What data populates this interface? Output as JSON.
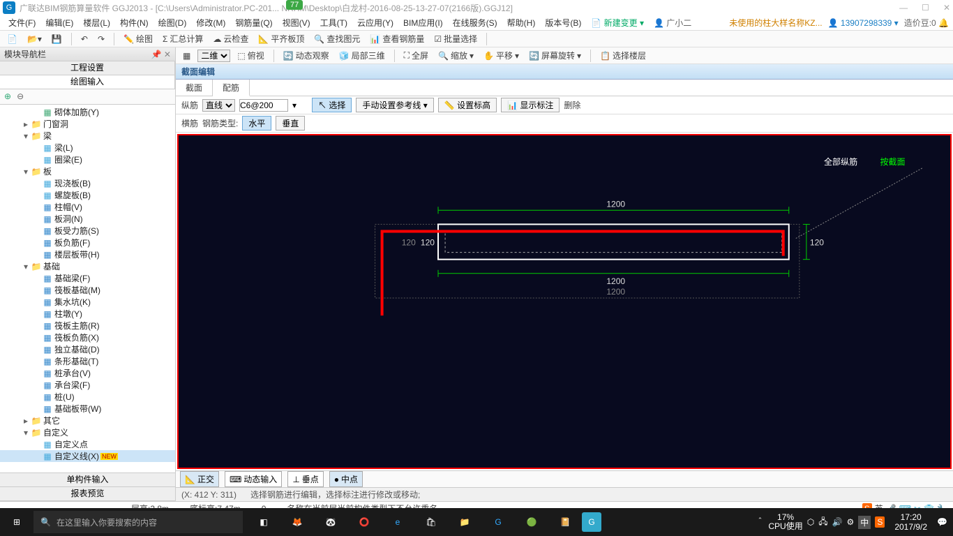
{
  "title": {
    "app": "广联达BIM钢筋算量软件 GGJ2013",
    "path": "- [C:\\Users\\Administrator.PC-201... NRHM\\Desktop\\白龙村-2016-08-25-13-27-07(2166版).GGJ12]",
    "badge": "77"
  },
  "menu": [
    "文件(F)",
    "编辑(E)",
    "楼层(L)",
    "构件(N)",
    "绘图(D)",
    "修改(M)",
    "钢筋量(Q)",
    "视图(V)",
    "工具(T)",
    "云应用(Y)",
    "BIM应用(I)",
    "在线服务(S)",
    "帮助(H)",
    "版本号(B)"
  ],
  "menu_right": {
    "new_change": "新建变更",
    "user": "广小二",
    "warn": "未使用的柱大样名称KZ...",
    "phone": "13907298339",
    "bean": "造价豆:0"
  },
  "toolbar1": {
    "draw": "绘图",
    "sum": "汇总计算",
    "cloud": "云检查",
    "flat": "平齐板顶",
    "find": "查找图元",
    "view_rebar": "查看钢筋量",
    "batch": "批量选择"
  },
  "toolbar2": {
    "view2d": "二维",
    "top": "俯视",
    "dyn": "动态观察",
    "local3d": "局部三维",
    "full": "全屏",
    "zoom": "缩放",
    "pan": "平移",
    "rotate": "屏幕旋转",
    "floor": "选择楼层"
  },
  "left": {
    "header": "模块导航栏",
    "tab1": "工程设置",
    "tab2": "绘图输入",
    "bt1": "单构件输入",
    "bt2": "报表预览"
  },
  "tree": [
    {
      "d": 2,
      "exp": "",
      "ico": "#4a7",
      "lbl": "砌体加筋(Y)"
    },
    {
      "d": 1,
      "exp": "▸",
      "ico": "folder",
      "lbl": "门窗洞"
    },
    {
      "d": 1,
      "exp": "▾",
      "ico": "folder",
      "lbl": "梁"
    },
    {
      "d": 2,
      "exp": "",
      "ico": "#4ad",
      "lbl": "梁(L)"
    },
    {
      "d": 2,
      "exp": "",
      "ico": "#4ad",
      "lbl": "圈梁(E)"
    },
    {
      "d": 1,
      "exp": "▾",
      "ico": "folder",
      "lbl": "板"
    },
    {
      "d": 2,
      "exp": "",
      "ico": "#4ad",
      "lbl": "现浇板(B)"
    },
    {
      "d": 2,
      "exp": "",
      "ico": "#4ad",
      "lbl": "螺旋板(B)"
    },
    {
      "d": 2,
      "exp": "",
      "ico": "#38c",
      "lbl": "柱帽(V)"
    },
    {
      "d": 2,
      "exp": "",
      "ico": "#38c",
      "lbl": "板洞(N)"
    },
    {
      "d": 2,
      "exp": "",
      "ico": "#38c",
      "lbl": "板受力筋(S)"
    },
    {
      "d": 2,
      "exp": "",
      "ico": "#38c",
      "lbl": "板负筋(F)"
    },
    {
      "d": 2,
      "exp": "",
      "ico": "#38c",
      "lbl": "楼层板带(H)"
    },
    {
      "d": 1,
      "exp": "▾",
      "ico": "folder",
      "lbl": "基础"
    },
    {
      "d": 2,
      "exp": "",
      "ico": "#38c",
      "lbl": "基础梁(F)"
    },
    {
      "d": 2,
      "exp": "",
      "ico": "#38c",
      "lbl": "筏板基础(M)"
    },
    {
      "d": 2,
      "exp": "",
      "ico": "#38c",
      "lbl": "集水坑(K)"
    },
    {
      "d": 2,
      "exp": "",
      "ico": "#38c",
      "lbl": "柱墩(Y)"
    },
    {
      "d": 2,
      "exp": "",
      "ico": "#38c",
      "lbl": "筏板主筋(R)"
    },
    {
      "d": 2,
      "exp": "",
      "ico": "#38c",
      "lbl": "筏板负筋(X)"
    },
    {
      "d": 2,
      "exp": "",
      "ico": "#38c",
      "lbl": "独立基础(D)"
    },
    {
      "d": 2,
      "exp": "",
      "ico": "#38c",
      "lbl": "条形基础(T)"
    },
    {
      "d": 2,
      "exp": "",
      "ico": "#38c",
      "lbl": "桩承台(V)"
    },
    {
      "d": 2,
      "exp": "",
      "ico": "#38c",
      "lbl": "承台梁(F)"
    },
    {
      "d": 2,
      "exp": "",
      "ico": "#38c",
      "lbl": "桩(U)"
    },
    {
      "d": 2,
      "exp": "",
      "ico": "#38c",
      "lbl": "基础板带(W)"
    },
    {
      "d": 1,
      "exp": "▸",
      "ico": "folder",
      "lbl": "其它"
    },
    {
      "d": 1,
      "exp": "▾",
      "ico": "folder",
      "lbl": "自定义"
    },
    {
      "d": 2,
      "exp": "",
      "ico": "#4ad",
      "lbl": "自定义点"
    },
    {
      "d": 2,
      "exp": "",
      "ico": "#4ad",
      "lbl": "自定义线(X)",
      "sel": true,
      "new": "NEW"
    }
  ],
  "section": {
    "header": "截面编辑",
    "tab1": "截面",
    "tab2": "配筋",
    "r1": {
      "l1": "纵筋",
      "sel1": "直线",
      "val": "C6@200",
      "select": "选择",
      "ref": "手动设置参考线",
      "elev": "设置标高",
      "show": "显示标注",
      "del": "删除"
    },
    "r2": {
      "l1": "横筋",
      "l2": "钢筋类型:",
      "b1": "水平",
      "b2": "垂直"
    },
    "legend": {
      "all": "全部纵筋",
      "by": "按截面"
    }
  },
  "snap": {
    "ortho": "正交",
    "dyn": "动态输入",
    "perp": "垂点",
    "mid": "中点"
  },
  "status": {
    "coord": "(X: 412 Y: 311)",
    "hint": "选择钢筋进行编辑，选择标注进行修改或移动;"
  },
  "info": {
    "h": "层高:2.8m",
    "bh": "底标高:7.47m",
    "zero": "0",
    "msg": "名称在当前层当前构件类型下不允许重名"
  },
  "taskbar": {
    "search": "在这里输入你要搜索的内容",
    "cpu": "17%",
    "cpu_lbl": "CPU使用",
    "time": "17:20",
    "date": "2017/9/2",
    "ime": "英",
    "ime2": "中"
  },
  "canvas": {
    "w": "1200",
    "h": "120"
  }
}
